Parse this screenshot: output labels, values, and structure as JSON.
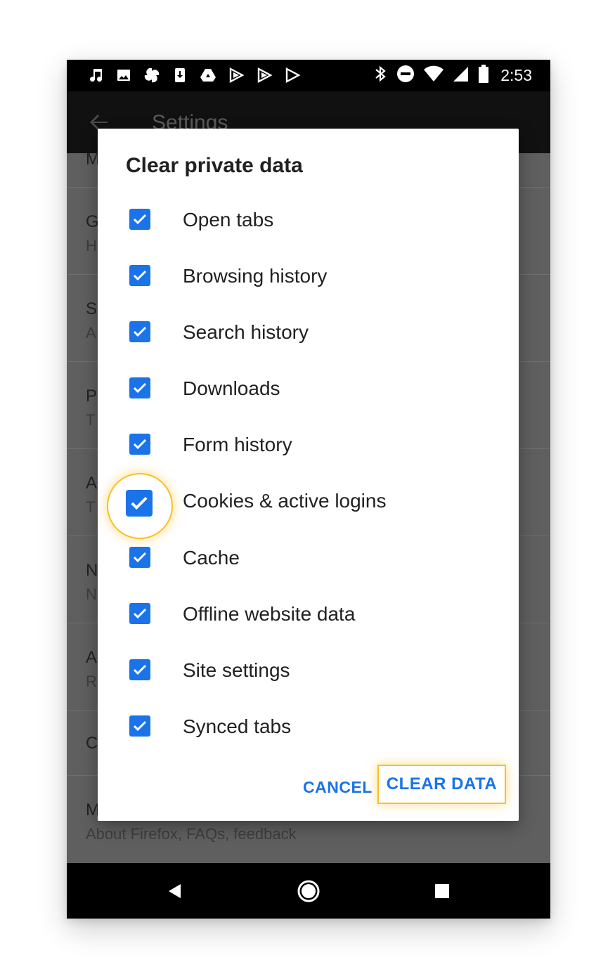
{
  "status_bar": {
    "left_icons": [
      "music-icon",
      "image-icon",
      "pinwheel-icon",
      "download-icon",
      "drive-icon",
      "play-store-icon",
      "play-store-icon",
      "play-store-icon"
    ],
    "right_icons": [
      "bluetooth-icon",
      "do-not-disturb-icon",
      "wifi-icon",
      "signal-icon",
      "battery-icon"
    ],
    "time": "2:53"
  },
  "app_bar": {
    "title": "Settings"
  },
  "settings_list": {
    "rows": [
      {
        "title": "M",
        "subtitle": ""
      },
      {
        "title": "G",
        "subtitle": "H"
      },
      {
        "title": "S",
        "subtitle": "A"
      },
      {
        "title": "P",
        "subtitle": "T"
      },
      {
        "title": "A",
        "subtitle": "T"
      },
      {
        "title": "N",
        "subtitle": "N"
      },
      {
        "title": "A",
        "subtitle": "R"
      },
      {
        "title": "C",
        "subtitle": ""
      },
      {
        "title": "M",
        "subtitle": "About Firefox, FAQs, feedback"
      }
    ]
  },
  "dialog": {
    "title": "Clear private data",
    "options": [
      {
        "label": "Open tabs",
        "checked": true
      },
      {
        "label": "Browsing history",
        "checked": true
      },
      {
        "label": "Search history",
        "checked": true
      },
      {
        "label": "Downloads",
        "checked": true
      },
      {
        "label": "Form history",
        "checked": true
      },
      {
        "label": "Cookies & active logins",
        "checked": true,
        "highlighted": true
      },
      {
        "label": "Cache",
        "checked": true
      },
      {
        "label": "Offline website data",
        "checked": true
      },
      {
        "label": "Site settings",
        "checked": true
      },
      {
        "label": "Synced tabs",
        "checked": true
      }
    ],
    "cancel_label": "CANCEL",
    "confirm_label": "CLEAR DATA"
  },
  "colors": {
    "accent": "#1a73e8",
    "highlight": "#fbbf24",
    "scrim": "#5f5f5f"
  },
  "nav_bar": {
    "buttons": [
      "back-icon",
      "home-icon",
      "recents-icon"
    ]
  }
}
